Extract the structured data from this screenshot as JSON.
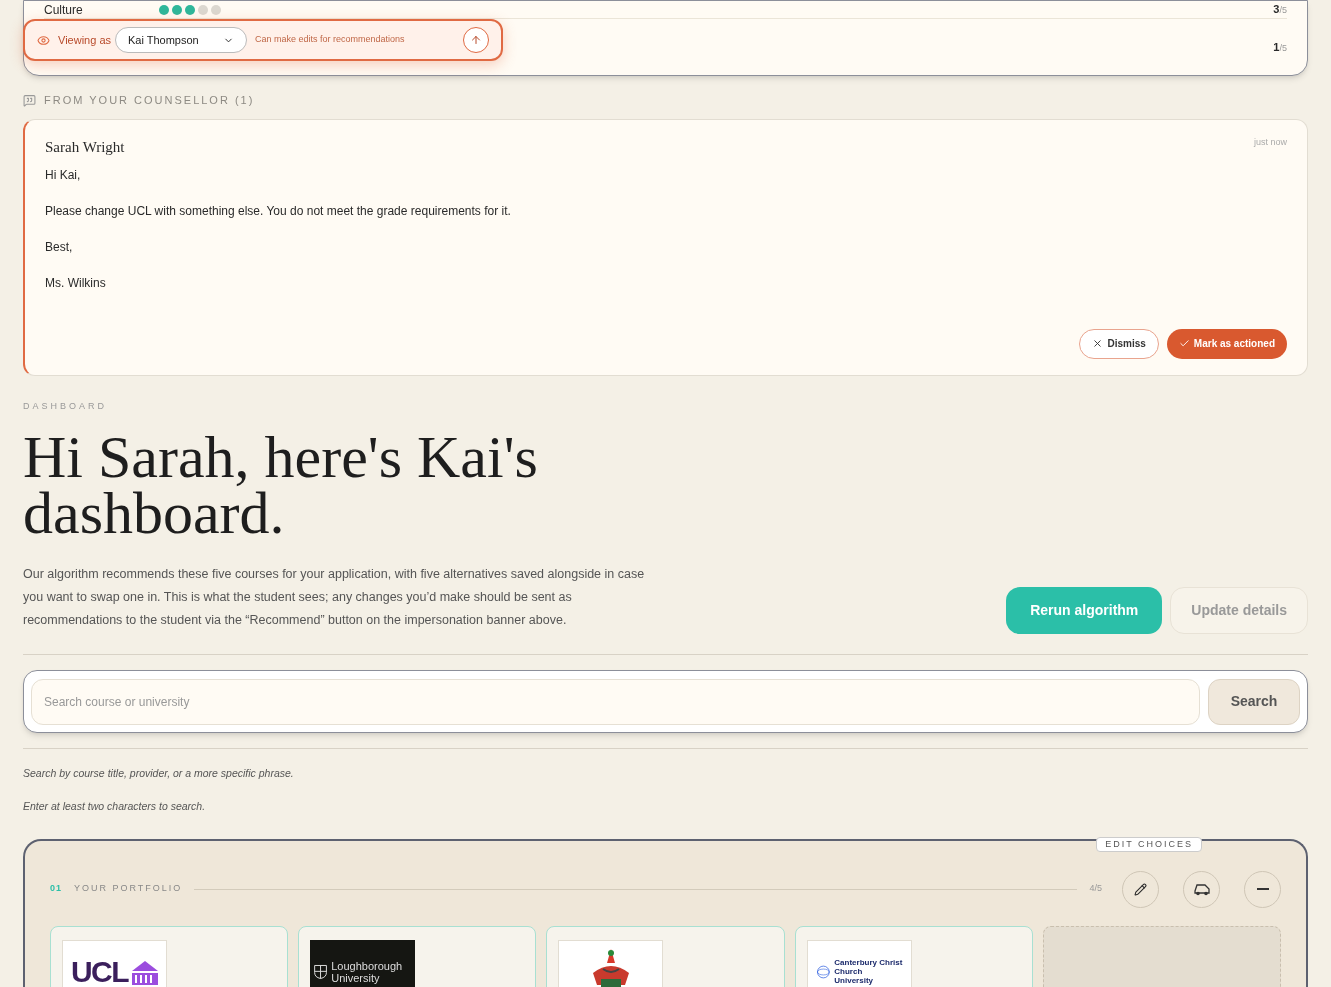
{
  "top_card": {
    "rows": [
      {
        "label": "Culture",
        "stars": 3,
        "score": "3",
        "total": "/5"
      },
      {
        "score": "1",
        "total": "/5"
      }
    ]
  },
  "banner": {
    "label": "Viewing as",
    "student": "Kai Thompson",
    "note": "Can make edits for recommendations"
  },
  "counsellor": {
    "heading": "FROM YOUR COUNSELLOR (1)",
    "message": {
      "sender": "Sarah Wright",
      "time": "just now",
      "lines": [
        "Hi Kai,",
        "Please change UCL with something else. You do not meet the grade requirements for it.",
        "Best,",
        "Ms. Wilkins"
      ],
      "actions": [
        {
          "label": "Dismiss",
          "kind": "secondary"
        },
        {
          "label": "Mark as actioned",
          "kind": "primary"
        }
      ]
    }
  },
  "dashboard": {
    "eyebrow": "DASHBOARD",
    "title": "Hi Sarah, here's Kai's dashboard.",
    "description": "Our algorithm recommends these five courses for your application, with five alternatives saved alongside in case you want to swap one in. This is what the student sees; any changes you’d make should be sent as recommendations to the student via the “Recommend” button on the impersonation banner above.",
    "buttons": [
      {
        "label": "Rerun algorithm",
        "kind": "primary"
      },
      {
        "label": "Update details",
        "kind": "secondary"
      }
    ]
  },
  "search": {
    "placeholder": "Search course or university",
    "button": "Search",
    "hints": [
      "Search by course title, provider, or a more specific phrase.",
      "Enter at least two characters to search."
    ]
  },
  "portfolio": {
    "tooltip": "EDIT CHOICES",
    "number": "01",
    "title": "YOUR PORTFOLIO",
    "count": "4",
    "total": "/5",
    "cards": [
      {
        "kind": "ucl",
        "logo_text": "UCL"
      },
      {
        "kind": "loughborough",
        "logo_text": "Loughborough University"
      },
      {
        "kind": "crest"
      },
      {
        "kind": "canterbury",
        "logo_text": "Canterbury Christ Church University"
      },
      {
        "kind": "empty"
      }
    ]
  }
}
